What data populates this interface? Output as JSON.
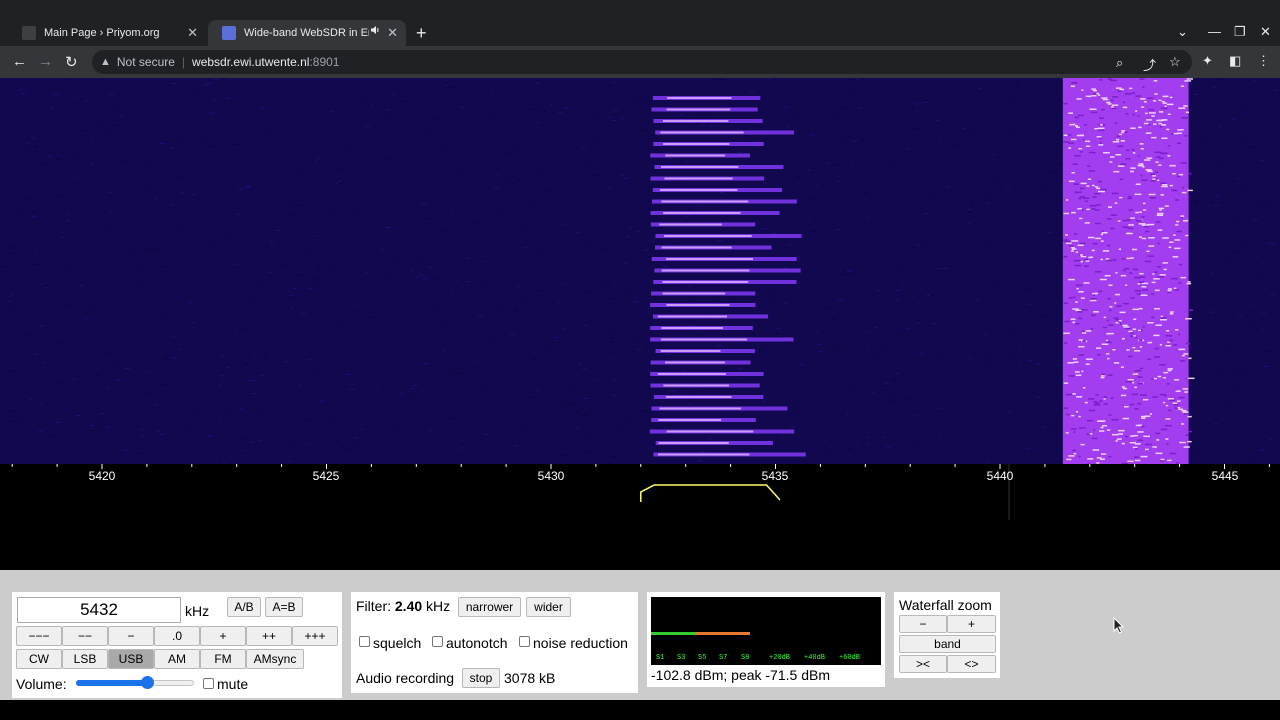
{
  "browser": {
    "tabs": [
      {
        "title": "Main Page › Priyom.org",
        "close": "✕"
      },
      {
        "title": "Wide-band WebSDR in Enschede",
        "audio_icon": "speaker-icon",
        "close": "✕"
      }
    ],
    "new_tab": "+",
    "address": {
      "security_label": "Not secure",
      "host": "websdr.ewi.utwente.nl",
      "port": ":8901"
    }
  },
  "waterfall": {
    "scale_unit": "kHz",
    "ticks": [
      "5420",
      "5425",
      "5430",
      "5435",
      "5440",
      "5445"
    ],
    "tick_values": [
      5420,
      5425,
      5430,
      5435,
      5440,
      5445
    ],
    "colors": {
      "background": "#11084f",
      "signal": "#b44dff",
      "passband": "#ffff66"
    }
  },
  "tuning": {
    "frequency": "5432",
    "unit": "kHz",
    "ab_label": "A/B",
    "a_eq_b_label": "A=B",
    "step_buttons": [
      "−−−",
      "−−",
      "−",
      ".0",
      "+",
      "++",
      "+++"
    ],
    "mode_buttons": [
      "CW",
      "LSB",
      "USB",
      "AM",
      "FM",
      "AMsync"
    ],
    "active_mode": "USB",
    "volume_label": "Volume:",
    "volume_level": 0.6,
    "mute_label": "mute"
  },
  "filter": {
    "label": "Filter:",
    "value": "2.40",
    "unit": "kHz",
    "narrower_label": "narrower",
    "wider_label": "wider",
    "squelch_label": "squelch",
    "autonotch_label": "autonotch",
    "noise_reduction_label": "noise reduction",
    "recording_label": "Audio recording",
    "stop_label": "stop",
    "recording_size": "3078 kB"
  },
  "smeter": {
    "labels": [
      "S1",
      "S3",
      "S5",
      "S7",
      "S9",
      "+20dB",
      "+40dB",
      "+60dB"
    ],
    "level_fraction": 0.43,
    "readout": "-102.8 dBm; peak  -71.5 dBm"
  },
  "zoom": {
    "title": "Waterfall zoom",
    "minus": "−",
    "plus": "+",
    "band": "band",
    "narrow": "><",
    "widen": "<>"
  }
}
